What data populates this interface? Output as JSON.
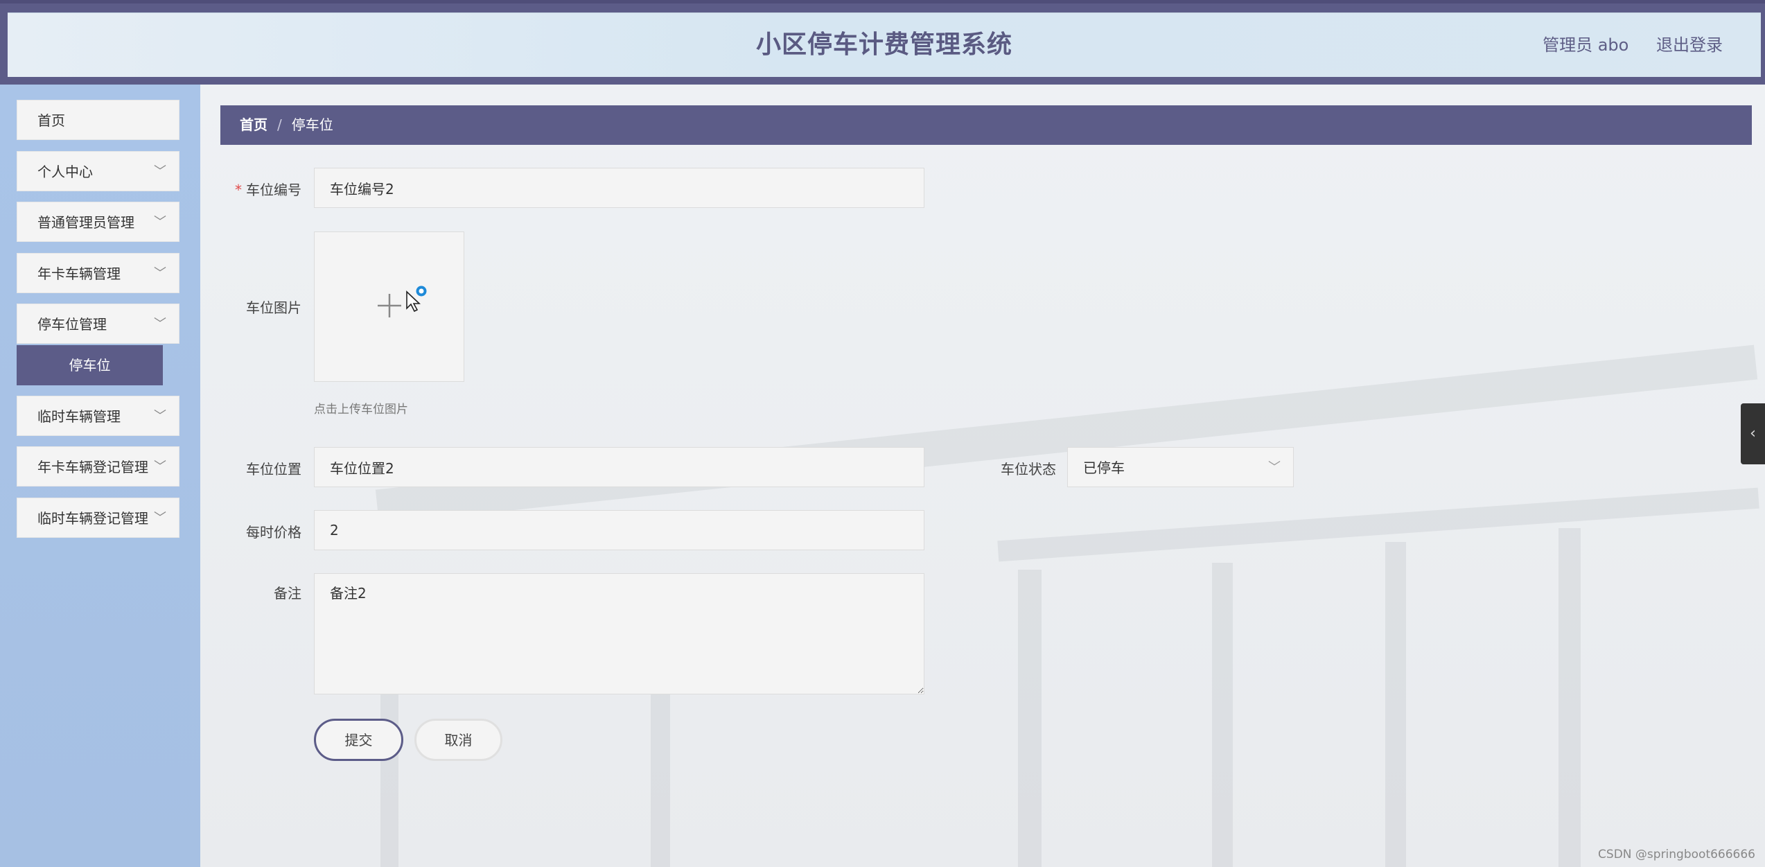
{
  "header": {
    "title": "小区停车计费管理系统",
    "user_label": "管理员 abo",
    "logout_label": "退出登录"
  },
  "sidebar": {
    "items": [
      {
        "label": "首页",
        "has_arrow": false
      },
      {
        "label": "个人中心",
        "has_arrow": true
      },
      {
        "label": "普通管理员管理",
        "has_arrow": true
      },
      {
        "label": "年卡车辆管理",
        "has_arrow": true
      },
      {
        "label": "停车位管理",
        "has_arrow": true,
        "expanded": true
      },
      {
        "label": "临时车辆管理",
        "has_arrow": true
      },
      {
        "label": "年卡车辆登记管理",
        "has_arrow": true
      },
      {
        "label": "临时车辆登记管理",
        "has_arrow": true
      }
    ],
    "active_sub_item": "停车位"
  },
  "breadcrumb": {
    "home": "首页",
    "separator": "/",
    "current": "停车位"
  },
  "form": {
    "space_number": {
      "label": "车位编号",
      "value": "车位编号2",
      "required": true
    },
    "space_image": {
      "label": "车位图片",
      "hint": "点击上传车位图片"
    },
    "space_location": {
      "label": "车位位置",
      "value": "车位位置2"
    },
    "space_status": {
      "label": "车位状态",
      "value": "已停车"
    },
    "hourly_price": {
      "label": "每时价格",
      "value": "2"
    },
    "remark": {
      "label": "备注",
      "value": "备注2"
    },
    "submit_label": "提交",
    "cancel_label": "取消"
  },
  "watermark": "CSDN @springboot666666",
  "colors": {
    "primary": "#5c5c88",
    "sidebar_bg": "#a9c4e8",
    "required": "#e04b4b",
    "cursor_badge": "#1e8ad8"
  }
}
